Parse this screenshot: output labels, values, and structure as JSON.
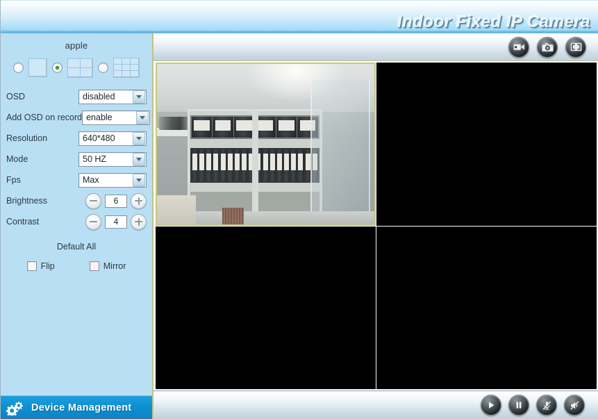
{
  "header": {
    "title": "Indoor Fixed IP Camera"
  },
  "sidebar": {
    "device_name": "apple",
    "layout_options": [
      {
        "name": "single",
        "grid": "1x1",
        "selected": false
      },
      {
        "name": "quad",
        "grid": "2x2",
        "selected": true
      },
      {
        "name": "nine",
        "grid": "3x3",
        "selected": false
      }
    ],
    "settings": [
      {
        "label": "OSD",
        "value": "disabled"
      },
      {
        "label": "Add OSD on record",
        "value": "enable"
      },
      {
        "label": "Resolution",
        "value": "640*480"
      },
      {
        "label": "Mode",
        "value": "50 HZ"
      },
      {
        "label": "Fps",
        "value": "Max"
      }
    ],
    "steppers": [
      {
        "label": "Brightness",
        "value": "6",
        "minus": "-",
        "plus": "+"
      },
      {
        "label": "Contrast",
        "value": "4",
        "minus": "-",
        "plus": "+"
      }
    ],
    "default_all_label": "Default All",
    "checkboxes": [
      {
        "label": "Flip",
        "checked": false
      },
      {
        "label": "Mirror",
        "checked": false
      }
    ],
    "device_management_label": "Device Management"
  },
  "toolbar_top": {
    "buttons": [
      {
        "name": "record-video",
        "label": "Record"
      },
      {
        "name": "snapshot",
        "label": "Snapshot"
      },
      {
        "name": "fullscreen",
        "label": "Full Screen"
      }
    ]
  },
  "toolbar_bottom": {
    "buttons": [
      {
        "name": "play",
        "label": "Play"
      },
      {
        "name": "pause",
        "label": "Pause"
      },
      {
        "name": "microphone-muted",
        "label": "Talk"
      },
      {
        "name": "speaker-muted",
        "label": "Audio"
      }
    ]
  },
  "video": {
    "layout": "2x2",
    "panes": [
      {
        "index": 1,
        "active": true,
        "has_stream": true
      },
      {
        "index": 2,
        "active": false,
        "has_stream": false
      },
      {
        "index": 3,
        "active": false,
        "has_stream": false
      },
      {
        "index": 4,
        "active": false,
        "has_stream": false
      }
    ]
  },
  "colors": {
    "sidebar_bg": "#b9dff5",
    "accent_blue": "#0d8fd0",
    "active_pane_border": "#c9c77f",
    "header_text": "#e9f5fb"
  }
}
